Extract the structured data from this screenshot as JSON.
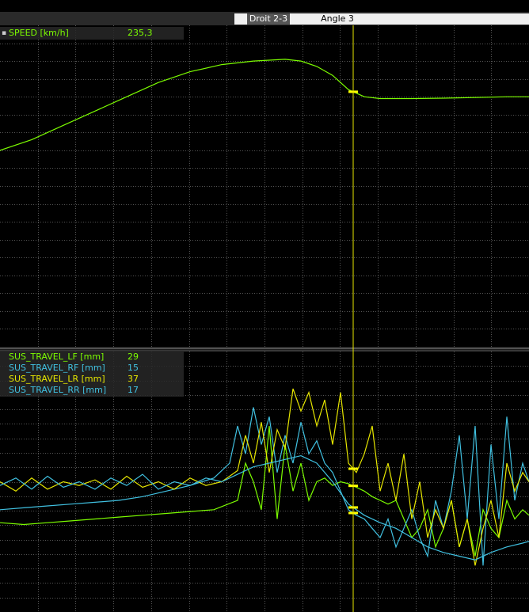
{
  "segments": [
    {
      "label": ""
    },
    {
      "label": "Droit 2-3"
    },
    {
      "label": "Angle 3"
    },
    {
      "label": ""
    }
  ],
  "cursor_marker": "▪",
  "chart_data": [
    {
      "type": "line",
      "series": [
        {
          "name": "SPEED [km/h]",
          "color": "#7cfc00",
          "cursor_value": "235,3",
          "x": [
            0,
            40,
            80,
            120,
            160,
            200,
            240,
            280,
            320,
            360,
            380,
            400,
            420,
            440,
            460,
            480,
            500,
            520,
            560,
            600,
            640,
            668
          ],
          "y": [
            205,
            208,
            212,
            216,
            220,
            224,
            227,
            229,
            230,
            230.5,
            230,
            228.5,
            226,
            222,
            220,
            219.5,
            219.5,
            219.5,
            219.6,
            219.8,
            220,
            220
          ]
        }
      ],
      "ylim": [
        150,
        240
      ],
      "xlim": [
        0,
        668
      ],
      "cursor_x": 446,
      "grid": true
    },
    {
      "type": "line",
      "series": [
        {
          "name": "SUS_TRAVEL_LF [mm]",
          "color": "#7cfc00",
          "cursor_value": "29",
          "x": [
            0,
            30,
            60,
            90,
            120,
            150,
            180,
            210,
            240,
            270,
            300,
            310,
            320,
            330,
            340,
            350,
            360,
            370,
            380,
            390,
            400,
            410,
            420,
            430,
            440,
            450,
            460,
            470,
            480,
            490,
            500,
            510,
            520,
            530,
            540,
            550,
            560,
            570,
            580,
            590,
            600,
            610,
            620,
            630,
            640,
            650,
            660,
            668
          ],
          "y": [
            8,
            7,
            8,
            9,
            10,
            11,
            12,
            13,
            14,
            15,
            20,
            40,
            30,
            15,
            60,
            10,
            50,
            25,
            40,
            20,
            30,
            32,
            28,
            30,
            29,
            27,
            25,
            22,
            20,
            18,
            20,
            10,
            0,
            5,
            15,
            -5,
            5,
            20,
            -5,
            10,
            -10,
            15,
            5,
            0,
            20,
            10,
            15,
            12
          ]
        },
        {
          "name": "SUS_TRAVEL_RF [mm]",
          "color": "#40c0e0",
          "cursor_value": "15",
          "x": [
            0,
            30,
            60,
            90,
            120,
            150,
            180,
            210,
            240,
            270,
            290,
            300,
            310,
            320,
            330,
            340,
            350,
            360,
            370,
            380,
            390,
            400,
            410,
            420,
            430,
            440,
            450,
            460,
            470,
            480,
            490,
            500,
            510,
            520,
            530,
            540,
            550,
            560,
            570,
            580,
            590,
            600,
            610,
            620,
            630,
            640,
            650,
            660,
            668
          ],
          "y": [
            15,
            16,
            17,
            18,
            19,
            20,
            22,
            25,
            28,
            32,
            40,
            60,
            45,
            70,
            50,
            65,
            35,
            55,
            40,
            62,
            45,
            52,
            40,
            35,
            25,
            15,
            12,
            10,
            5,
            0,
            10,
            -5,
            5,
            15,
            0,
            -10,
            20,
            5,
            25,
            55,
            10,
            60,
            -15,
            50,
            10,
            65,
            20,
            40,
            30
          ]
        },
        {
          "name": "SUS_TRAVEL_LR [mm]",
          "color": "#e6e600",
          "cursor_value": "37",
          "x": [
            0,
            20,
            40,
            60,
            80,
            100,
            120,
            140,
            160,
            180,
            200,
            220,
            240,
            260,
            280,
            300,
            310,
            320,
            330,
            340,
            350,
            360,
            370,
            380,
            390,
            400,
            410,
            420,
            430,
            440,
            450,
            460,
            470,
            480,
            490,
            500,
            510,
            520,
            530,
            540,
            550,
            560,
            570,
            580,
            590,
            600,
            610,
            620,
            630,
            640,
            650,
            660,
            668
          ],
          "y": [
            30,
            25,
            32,
            26,
            30,
            28,
            31,
            26,
            33,
            27,
            30,
            26,
            32,
            28,
            30,
            36,
            55,
            40,
            62,
            35,
            58,
            48,
            80,
            68,
            78,
            60,
            74,
            50,
            78,
            40,
            35,
            45,
            60,
            25,
            40,
            20,
            45,
            10,
            30,
            0,
            15,
            5,
            20,
            -5,
            10,
            -15,
            5,
            20,
            0,
            40,
            25,
            35,
            30
          ]
        },
        {
          "name": "SUS_TRAVEL_RR [mm]",
          "color": "#40c0e0",
          "cursor_value": "17",
          "x": [
            0,
            20,
            40,
            60,
            80,
            100,
            120,
            140,
            160,
            180,
            200,
            220,
            240,
            260,
            280,
            300,
            320,
            340,
            360,
            380,
            400,
            420,
            440,
            460,
            480,
            500,
            520,
            540,
            560,
            580,
            600,
            620,
            640,
            660,
            668
          ],
          "y": [
            28,
            32,
            26,
            33,
            27,
            30,
            26,
            32,
            28,
            34,
            26,
            30,
            28,
            32,
            30,
            34,
            38,
            40,
            42,
            44,
            40,
            30,
            18,
            12,
            8,
            5,
            0,
            -5,
            -8,
            -10,
            -12,
            -8,
            -5,
            -3,
            -2
          ]
        }
      ],
      "ylim": [
        -40,
        100
      ],
      "xlim": [
        0,
        668
      ],
      "cursor_x": 446,
      "grid": true
    }
  ]
}
